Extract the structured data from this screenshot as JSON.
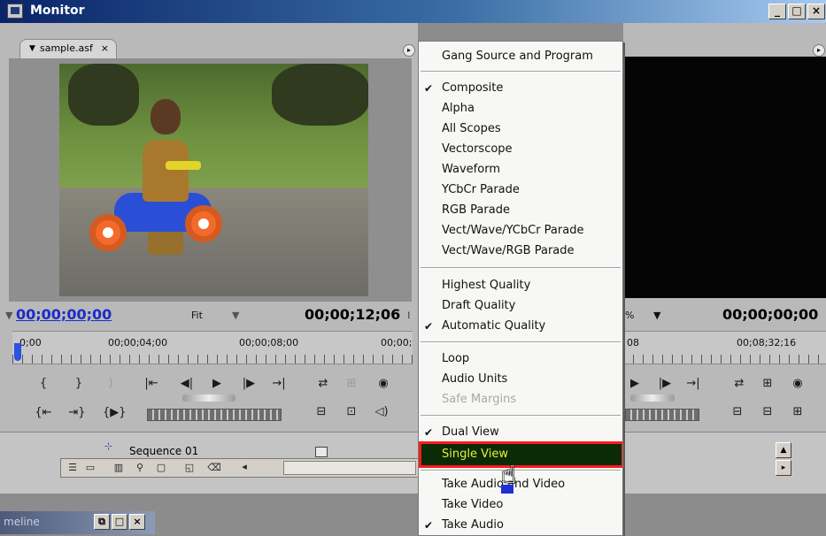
{
  "window": {
    "title": "Monitor",
    "controls": [
      "_",
      "□",
      "×"
    ]
  },
  "source": {
    "tab_label": "sample.asf",
    "tab_close": "×",
    "timecode_current": "00;00;00;00",
    "fit_label": "Fit",
    "duration": "00;00;12;06",
    "ruler_labels": [
      "0;00",
      "00;00;04;00",
      "00;00;08;00",
      "00;00;"
    ]
  },
  "program": {
    "zoom_label": "%",
    "timecode": "00;00;00;00",
    "ruler_labels": [
      "08",
      "00;08;32;16"
    ]
  },
  "project": {
    "sequence_label": "Sequence 01"
  },
  "timeline": {
    "label": "meline"
  },
  "menu": {
    "items": [
      {
        "label": "Gang Source and Program",
        "checked": false
      },
      {
        "label": "Composite",
        "checked": true
      },
      {
        "label": "Alpha",
        "checked": false
      },
      {
        "label": "All Scopes",
        "checked": false
      },
      {
        "label": "Vectorscope",
        "checked": false
      },
      {
        "label": "Waveform",
        "checked": false
      },
      {
        "label": "YCbCr Parade",
        "checked": false
      },
      {
        "label": "RGB Parade",
        "checked": false
      },
      {
        "label": "Vect/Wave/YCbCr Parade",
        "checked": false
      },
      {
        "label": "Vect/Wave/RGB Parade",
        "checked": false
      },
      {
        "label": "Highest Quality",
        "checked": false
      },
      {
        "label": "Draft Quality",
        "checked": false
      },
      {
        "label": "Automatic Quality",
        "checked": true
      },
      {
        "label": "Loop",
        "checked": false
      },
      {
        "label": "Audio Units",
        "checked": false
      },
      {
        "label": "Safe Margins",
        "checked": false,
        "disabled": true
      },
      {
        "label": "Dual View",
        "checked": true
      },
      {
        "label": "Single View",
        "checked": false,
        "highlighted": true
      },
      {
        "label": "Take Audio and Video",
        "checked": false
      },
      {
        "label": "Take Video",
        "checked": false
      },
      {
        "label": "Take Audio",
        "checked": true
      }
    ]
  }
}
